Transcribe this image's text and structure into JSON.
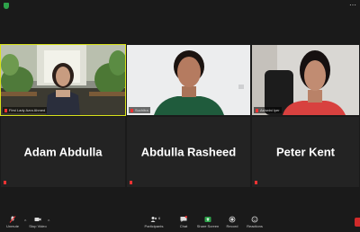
{
  "participants": [
    {
      "video_label": "First Lady Azra Ahmed",
      "muted": true
    },
    {
      "video_label": "Suchitra",
      "muted": true
    },
    {
      "video_label": "Ashwini Iyer",
      "muted": true
    },
    {
      "name": "Adam Abdulla",
      "muted": true
    },
    {
      "name": "Abdulla Rasheed",
      "muted": true
    },
    {
      "name": "Peter Kent",
      "muted": true
    }
  ],
  "toolbar": {
    "unmute": "Unmute",
    "stop_video": "Stop Video",
    "participants": "Participants",
    "participants_count": "6",
    "chat": "Chat",
    "share_screen": "Share Screen",
    "record": "Record",
    "reactions": "Reactions"
  },
  "colors": {
    "active_speaker": "#d8e21a",
    "share_green": "#2da24a",
    "muted_red": "#e33333"
  }
}
